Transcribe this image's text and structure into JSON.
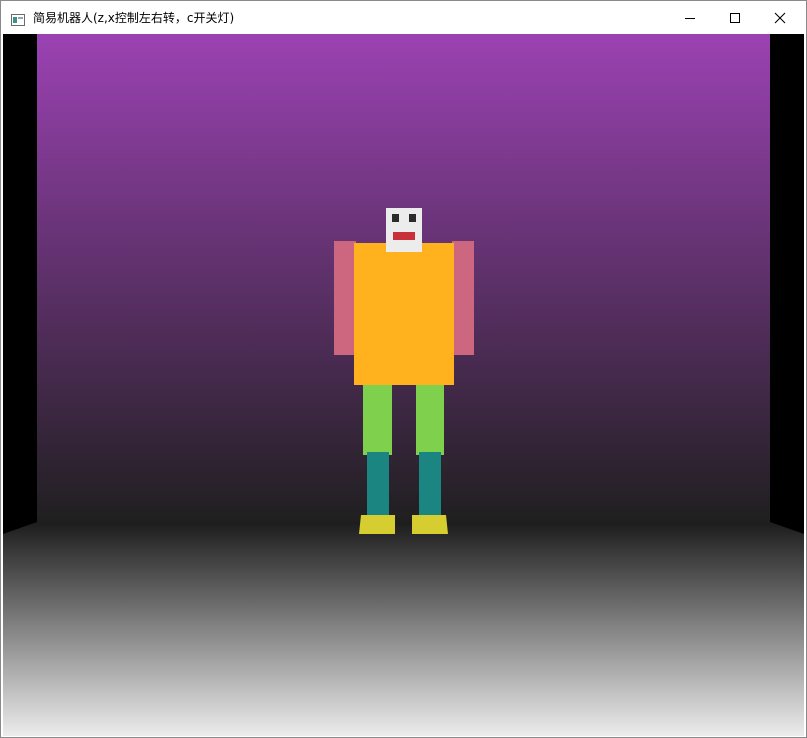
{
  "window": {
    "title": "简易机器人(z,x控制左右转，c开关灯)",
    "controls": [
      "minimize-icon",
      "maximize-icon",
      "close-icon"
    ]
  },
  "scene": {
    "back_wall_top_color": "#9b42b3",
    "back_wall_bottom_color": "#1f1f1f",
    "floor_top_color": "#1c1c1c",
    "floor_bottom_color": "#ececec",
    "side_wall_color": "#000000",
    "robot": {
      "head_color": "#ececec",
      "eye_color": "#2b2b2b",
      "mouth_color": "#c8303a",
      "torso_color": "#ffb11e",
      "arm_color": "#cd667f",
      "thigh_color": "#7fd04d",
      "shin_color": "#1a8581",
      "foot_color": "#d6cd30"
    }
  }
}
